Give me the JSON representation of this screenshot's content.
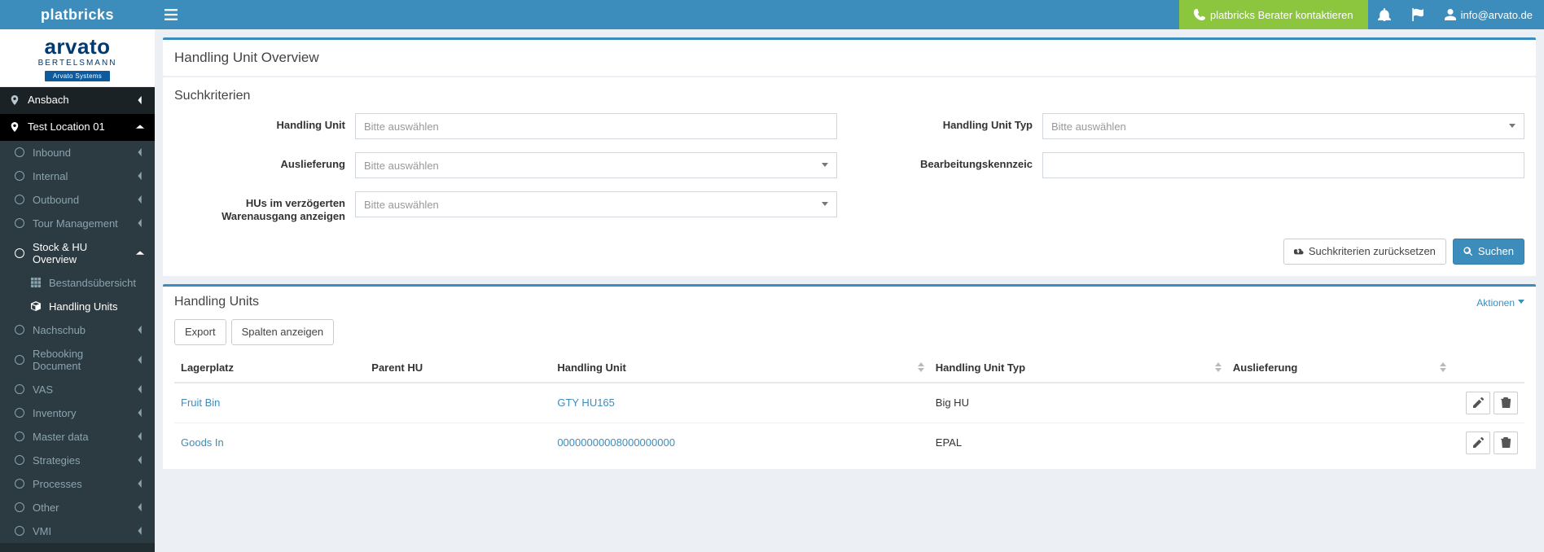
{
  "brand": "platbricks",
  "logo": {
    "line1": "arvato",
    "line2": "BERTELSMANN",
    "badge": "Arvato Systems"
  },
  "topbar": {
    "contact_label": "platbricks Berater kontaktieren",
    "user_email": "info@arvato.de"
  },
  "sidebar": {
    "loc1": "Ansbach",
    "loc2": "Test Location 01",
    "items": [
      {
        "label": "Inbound"
      },
      {
        "label": "Internal"
      },
      {
        "label": "Outbound"
      },
      {
        "label": "Tour Management"
      },
      {
        "label": "Stock & HU Overview",
        "open": true,
        "children": [
          {
            "label": "Bestandsübersicht"
          },
          {
            "label": "Handling Units",
            "active": true
          }
        ]
      },
      {
        "label": "Nachschub"
      },
      {
        "label": "Rebooking Document"
      },
      {
        "label": "VAS"
      },
      {
        "label": "Inventory"
      },
      {
        "label": "Master data"
      },
      {
        "label": "Strategies"
      },
      {
        "label": "Processes"
      },
      {
        "label": "Other"
      },
      {
        "label": "VMI"
      }
    ]
  },
  "page": {
    "title": "Handling Unit Overview",
    "section1_title": "Suchkriterien",
    "labels": {
      "hu": "Handling Unit",
      "hu_type": "Handling Unit Typ",
      "delivery": "Auslieferung",
      "proc_flag": "Bearbeitungskennzeic",
      "delayed": "HUs im verzögerten Warenausgang anzeigen"
    },
    "placeholders": {
      "select": "Bitte auswählen"
    },
    "buttons": {
      "reset": "Suchkriterien zurücksetzen",
      "search": "Suchen",
      "export": "Export",
      "columns": "Spalten anzeigen",
      "actions": "Aktionen"
    },
    "section2_title": "Handling Units",
    "table": {
      "headers": {
        "lagerplatz": "Lagerplatz",
        "parent": "Parent HU",
        "hu": "Handling Unit",
        "hu_type": "Handling Unit Typ",
        "delivery": "Auslieferung"
      },
      "rows": [
        {
          "lagerplatz": "Fruit Bin",
          "parent": "",
          "hu": "GTY HU165",
          "hu_type": "Big HU",
          "delivery": ""
        },
        {
          "lagerplatz": "Goods In",
          "parent": "",
          "hu": "00000000008000000000",
          "hu_type": "EPAL",
          "delivery": ""
        }
      ]
    }
  }
}
